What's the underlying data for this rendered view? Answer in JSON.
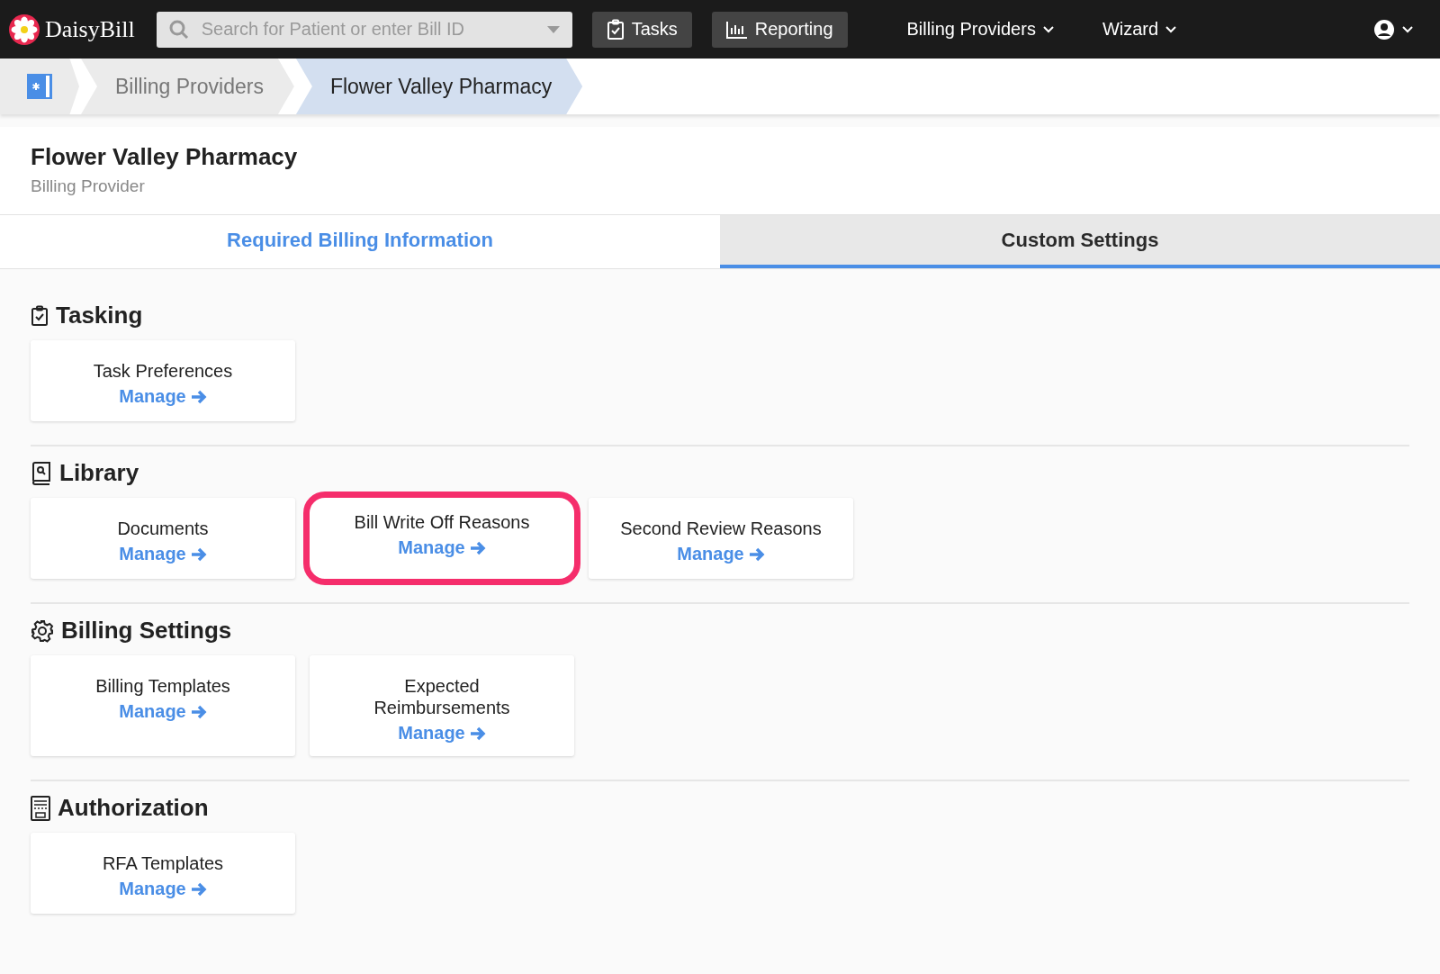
{
  "navbar": {
    "logo": "DaisyBill",
    "search": {
      "placeholder": "Search for Patient or enter Bill ID"
    },
    "items": [
      {
        "label": "Tasks",
        "kind": "button"
      },
      {
        "label": "Reporting",
        "kind": "button"
      },
      {
        "label": "Billing Providers",
        "kind": "menu"
      },
      {
        "label": "Wizard",
        "kind": "menu"
      }
    ]
  },
  "breadcrumb": [
    {
      "label": "Billing Providers",
      "selected": false
    },
    {
      "label": "Flower Valley Pharmacy",
      "selected": true
    }
  ],
  "header": {
    "title": "Flower Valley Pharmacy",
    "subtitle": "Billing Provider"
  },
  "tabs": [
    {
      "label": "Required Billing Information",
      "selected": false
    },
    {
      "label": "Custom Settings",
      "selected": true
    }
  ],
  "sections": [
    {
      "title": "Tasking",
      "cards": [
        {
          "title": "Task Preferences",
          "link": "Manage",
          "highlighted": false
        }
      ]
    },
    {
      "title": "Library",
      "cards": [
        {
          "title": "Documents",
          "link": "Manage",
          "highlighted": false
        },
        {
          "title": "Bill Write Off Reasons",
          "link": "Manage",
          "highlighted": true
        },
        {
          "title": "Second Review Reasons",
          "link": "Manage",
          "highlighted": false
        }
      ]
    },
    {
      "title": "Billing Settings",
      "cards": [
        {
          "title": "Billing Templates",
          "link": "Manage",
          "highlighted": false
        },
        {
          "title": "Expected Reimbursements",
          "link": "Manage",
          "highlighted": false
        }
      ]
    },
    {
      "title": "Authorization",
      "cards": [
        {
          "title": "RFA Templates",
          "link": "Manage",
          "highlighted": false
        }
      ]
    }
  ]
}
